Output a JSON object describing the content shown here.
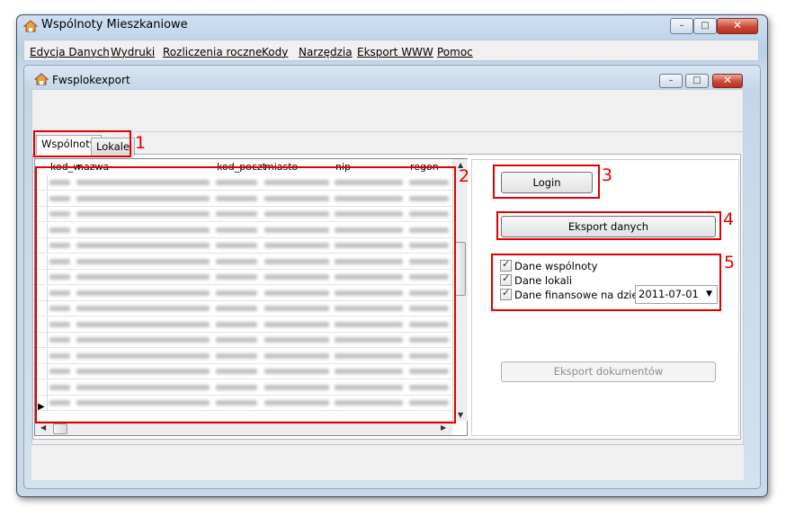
{
  "window": {
    "title": "Wspólnoty Mieszkaniowe",
    "min": "–",
    "max": "□",
    "close": "✕"
  },
  "menu": [
    "Edycja Danych",
    "Wydruki",
    "Rozliczenia roczne",
    "Kody",
    "Narzędzia",
    "Eksport WWW",
    "Pomoc"
  ],
  "child": {
    "title": "Fwsplokexport",
    "min": "–",
    "max": "□",
    "close": "✕"
  },
  "tabs": [
    "Wspólnoty",
    "Lokale"
  ],
  "grid": {
    "columns": [
      "kod_w",
      "nazwa",
      "kod_poczt",
      "miasto",
      "nip",
      "regon"
    ],
    "row_count": 15
  },
  "actions": {
    "login": "Login",
    "export_data": "Eksport danych",
    "export_docs": "Eksport dokumentów"
  },
  "options": {
    "dane_wspolnoty": {
      "label": "Dane wspólnoty",
      "checked": true
    },
    "dane_lokali": {
      "label": "Dane lokali",
      "checked": true
    },
    "dane_finansowe": {
      "label": "Dane finansowe na dzień:",
      "checked": true
    },
    "date_value": "2011-07-01"
  },
  "annotations": [
    "1",
    "2",
    "3",
    "4",
    "5"
  ],
  "colors": {
    "annotation": "#e00000",
    "chrome": "#c9d9ea"
  }
}
